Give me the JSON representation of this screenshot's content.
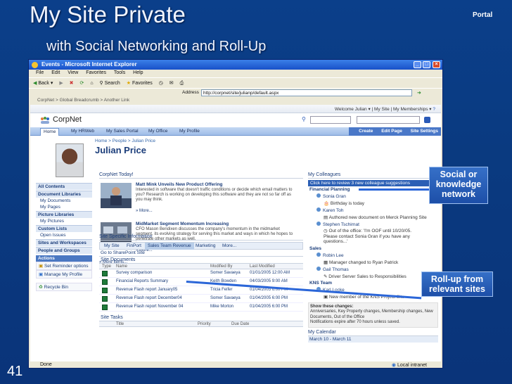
{
  "slide": {
    "title": "My Site Private",
    "subtitle": "with Social Networking and Roll-Up",
    "portal_label": "Portal",
    "slide_number": "41"
  },
  "browser": {
    "window_title": "Events - Microsoft Internet Explorer",
    "menu": [
      "File",
      "Edit",
      "View",
      "Favorites",
      "Tools",
      "Help"
    ],
    "toolbar": [
      "Back",
      "Search",
      "Favorites"
    ],
    "address_label": "Address",
    "address": "http://corpnet/site/julianp/default.aspx",
    "links": "CorpNet > Global Breadcrumb > Another Link",
    "status_left": "Done",
    "status_right": "Local intranet"
  },
  "sharepoint": {
    "welcome": "Welcome Julian",
    "top_links": [
      "My Site",
      "My Memberships"
    ],
    "brand": "CorpNet",
    "nav_tabs": [
      "Home",
      "My HRWeb",
      "My Sales Portal",
      "My Office",
      "My Profile"
    ],
    "actions": [
      "Create",
      "Edit Page",
      "Site Settings"
    ],
    "breadcrumb": "Home > People > Julian Price",
    "person_name": "Julian Price"
  },
  "left_nav": {
    "items": [
      {
        "label": "All Contents",
        "header": true
      },
      {
        "label": "Document Libraries",
        "header": true
      },
      {
        "label": "My Documents",
        "header": false
      },
      {
        "label": "My Pages",
        "header": false
      },
      {
        "label": "Picture Libraries",
        "header": true
      },
      {
        "label": "My Pictures",
        "header": false
      },
      {
        "label": "Custom Lists",
        "header": true
      },
      {
        "label": "Open Issues",
        "header": false
      },
      {
        "label": "Sites and Workspaces",
        "header": true
      },
      {
        "label": "People and Groups",
        "header": true
      }
    ],
    "actions_title": "Actions",
    "actions": [
      "Set Reminder options",
      "Manage My Profile"
    ],
    "recycle_bin": "Recycle Bin"
  },
  "corpnet_today": {
    "title": "CorpNet Today!",
    "news": [
      {
        "headline": "Matt Mink Unveils New Product Offering",
        "body": "Interested in software that doesn't traffic conditions or decide which email matters to you? Research is working on developing this software and they are not so far off as you may think.",
        "more": "» More..."
      },
      {
        "headline": "MidMarket Segment Momentum Increasing",
        "body": "CFO Mason Bendixen discusses the company's momentum in the midmarket segment, its evolving strategy for serving this market and ways in which he hopes to penetrate other markets as well.",
        "more": "» More..."
      }
    ],
    "more_items": "» More Items..."
  },
  "site_info": {
    "title": "Site Specific Information",
    "tabs": [
      "My Site",
      "FinPort",
      "Sales Team Revenue",
      "Marketing",
      "More..."
    ],
    "go_link": "Go to SharePoint Site",
    "documents_title": "Site Documents",
    "columns": [
      "Type",
      "Name",
      "Modified By",
      "Last Modified"
    ],
    "rows": [
      [
        "Survey comparison",
        "Somer Savaeya",
        "01/01/2005 12:00 AM"
      ],
      [
        "Financial Reports Summary",
        "Keith Bowden",
        "04/03/2005 9:00 AM"
      ],
      [
        "Revenue Flash report January05",
        "Tricia Feifer",
        "01/04/2005 6:00 PM"
      ],
      [
        "Revenue Flash report December04",
        "Somer Savaeya",
        "01/04/2005 6:00 PM"
      ],
      [
        "Revenue Flash report November 04",
        "Mike Morton",
        "01/04/2005 6:00 PM"
      ]
    ],
    "tasks_title": "Site Tasks",
    "task_columns": [
      "Title",
      "Priority",
      "Due Date"
    ]
  },
  "colleagues": {
    "title": "My Colleagues",
    "review_link": "Click here to review 3 new colleague suggestions",
    "sections": [
      {
        "name": "Financial Planning",
        "entries": [
          {
            "person": "Sonia Gran",
            "notes": [
              "Birthday is today"
            ]
          },
          {
            "person": "Karen Toh",
            "notes": [
              "Authored new document on Merck Planning Site"
            ]
          },
          {
            "person": "Stephen Tschirnat",
            "notes": [
              "Out of the office: 'I'm OOF until 10/20/05. Please contact Sonia Gran if you have any questions...'"
            ]
          }
        ]
      },
      {
        "name": "Sales",
        "entries": [
          {
            "person": "Robin Lee",
            "notes": [
              "Manager changed to Ryan Patrick"
            ]
          },
          {
            "person": "Gail Thomas",
            "notes": [
              "Driver Server Sales to Responsibilities"
            ]
          }
        ]
      },
      {
        "name": "KNS Team",
        "entries": [
          {
            "person": "Karl Locke",
            "notes": [
              "New member of the KNS Project Site"
            ]
          }
        ]
      }
    ],
    "changes_title": "Show these changes:",
    "changes_text": "Anniversaries, Key Property changes, Membership changes, New Documents, Out of the Office",
    "changes_note": "Notifications expire after 70 hours unless saved.",
    "calendar_title": "My Calendar",
    "calendar_range": "March 10 - March 11"
  },
  "callouts": {
    "social": "Social or knowledge network",
    "rollup": "Roll-up from relevant sites"
  },
  "colors": {
    "slide_bg": "#0b3f8a",
    "callout": "#2b5fb5",
    "sp_blue": "#1b3d7a"
  }
}
